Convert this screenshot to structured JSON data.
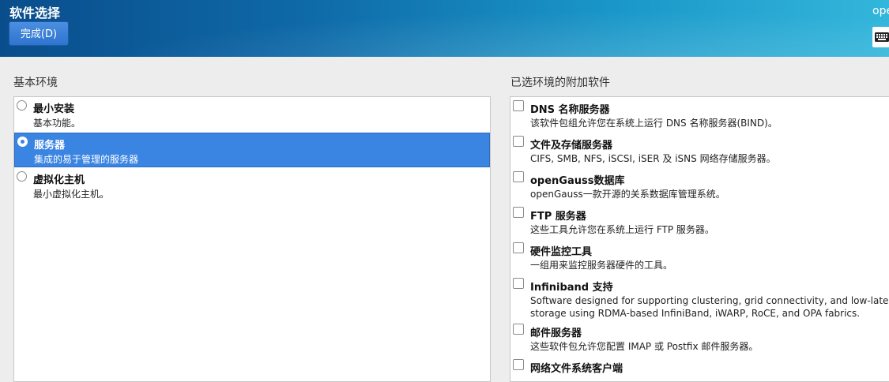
{
  "header": {
    "title": "软件选择",
    "done_button": "完成(D)",
    "product": "openEuler"
  },
  "base_env": {
    "label": "基本环境",
    "items": [
      {
        "name": "最小安装",
        "desc": "基本功能。",
        "selected": false
      },
      {
        "name": "服务器",
        "desc": "集成的易于管理的服务器",
        "selected": true
      },
      {
        "name": "虚拟化主机",
        "desc": "最小虚拟化主机。",
        "selected": false
      }
    ]
  },
  "addons": {
    "label": "已选环境的附加软件",
    "items": [
      {
        "name": "DNS 名称服务器",
        "desc": "该软件包组允许您在系统上运行 DNS 名称服务器(BIND)。",
        "checked": false
      },
      {
        "name": "文件及存储服务器",
        "desc": "CIFS, SMB, NFS, iSCSI, iSER 及 iSNS 网络存储服务器。",
        "checked": false
      },
      {
        "name": "openGauss数据库",
        "desc": "openGauss一款开源的关系数据库管理系统。",
        "checked": false
      },
      {
        "name": "FTP 服务器",
        "desc": "这些工具允许您在系统上运行 FTP 服务器。",
        "checked": false
      },
      {
        "name": "硬件监控工具",
        "desc": "一组用来监控服务器硬件的工具。",
        "checked": false
      },
      {
        "name": "Infiniband 支持",
        "desc": "Software designed for supporting clustering, grid connectivity, and low-latency, high bandwidth",
        "desc2": "storage using RDMA-based InfiniBand, iWARP, RoCE, and OPA fabrics.",
        "checked": false
      },
      {
        "name": "邮件服务器",
        "desc": "这些软件包允许您配置 IMAP 或 Postfix 邮件服务器。",
        "checked": false
      },
      {
        "name": "网络文件系统客户端",
        "desc": "",
        "checked": false
      }
    ]
  }
}
